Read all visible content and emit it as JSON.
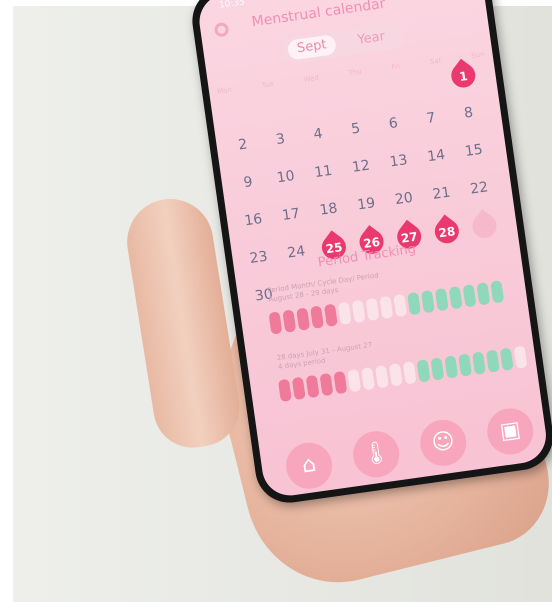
{
  "status": {
    "time": "10:35"
  },
  "header": {
    "title": "Menstrual calendar",
    "settings_icon": "gear-icon"
  },
  "view_toggle": {
    "selected": "Sept",
    "other": "Year"
  },
  "weekdays": [
    "Mon",
    "Tue",
    "Wed",
    "Thu",
    "Fri",
    "Sat",
    "Sun"
  ],
  "calendar": {
    "days": [
      "1",
      "2",
      "3",
      "4",
      "5",
      "6",
      "7",
      "8",
      "9",
      "10",
      "11",
      "12",
      "13",
      "14",
      "15",
      "16",
      "17",
      "18",
      "19",
      "20",
      "21",
      "22",
      "23",
      "24",
      "25",
      "26",
      "27",
      "28",
      "29",
      "30"
    ],
    "period_days": [
      "1",
      "25",
      "26",
      "27",
      "28"
    ],
    "predicted_days": [
      "29"
    ],
    "colors": {
      "period": "#e9396f",
      "predicted": "#f6b8cb",
      "day_text": "#6e6f8a"
    }
  },
  "period_tracking": {
    "title": "Period Tracking",
    "cycles": [
      {
        "dates": "Period Month/ Cycle Day/ Period",
        "detail": "August 28 - 29 days"
      },
      {
        "dates": "28 days  July 31 - August 27",
        "detail": "4 days period"
      }
    ],
    "colors": {
      "period": "#f07a9a",
      "fertile": "#8fd8bb",
      "other": "#fbe3ea"
    }
  },
  "bottom_nav": [
    {
      "icon": "home-icon",
      "glyph": "⌂"
    },
    {
      "icon": "thermometer-icon",
      "glyph": "🌡"
    },
    {
      "icon": "face-icon",
      "glyph": "☺"
    },
    {
      "icon": "calendar-add-icon",
      "glyph": "▣"
    }
  ]
}
